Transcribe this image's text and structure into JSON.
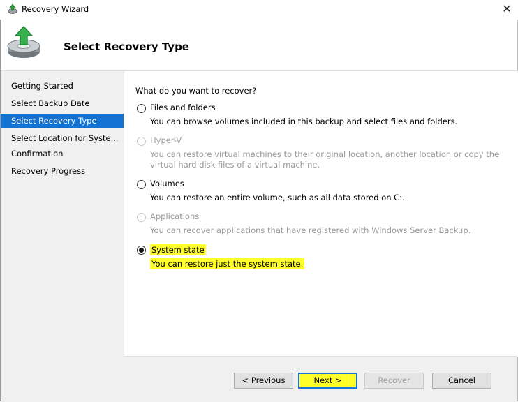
{
  "window": {
    "title": "Recovery Wizard",
    "close_glyph": "✕",
    "icon": "wizard-app-icon"
  },
  "header": {
    "title": "Select Recovery Type",
    "icon": "backup-restore-icon"
  },
  "nav": {
    "items": [
      {
        "label": "Getting Started",
        "selected": false
      },
      {
        "label": "Select Backup Date",
        "selected": false
      },
      {
        "label": "Select Recovery Type",
        "selected": true
      },
      {
        "label": "Select Location for Syste...",
        "selected": false
      },
      {
        "label": "Confirmation",
        "selected": false
      },
      {
        "label": "Recovery Progress",
        "selected": false
      }
    ]
  },
  "main": {
    "question": "What do you want to recover?",
    "options": [
      {
        "label": "Files and folders",
        "description": "You can browse volumes included in this backup and select files and folders.",
        "enabled": true,
        "checked": false
      },
      {
        "label": "Hyper-V",
        "description": "You can restore virtual machines to their original location, another location or copy the virtual hard disk files of a virtual machine.",
        "enabled": false,
        "checked": false
      },
      {
        "label": "Volumes",
        "description": "You can restore an entire volume, such as all data stored on C:.",
        "enabled": true,
        "checked": false
      },
      {
        "label": "Applications",
        "description": "You can recover applications that have registered with Windows Server Backup.",
        "enabled": false,
        "checked": false
      },
      {
        "label": "System state",
        "description": "You can restore just the system state.",
        "enabled": true,
        "checked": true
      }
    ]
  },
  "buttons": {
    "previous": "< Previous",
    "next": "Next >",
    "recover": "Recover",
    "cancel": "Cancel"
  },
  "colors": {
    "nav_selected": "#1272d3",
    "highlight": "#ffff2a",
    "default_button_border": "#1a73d8"
  }
}
